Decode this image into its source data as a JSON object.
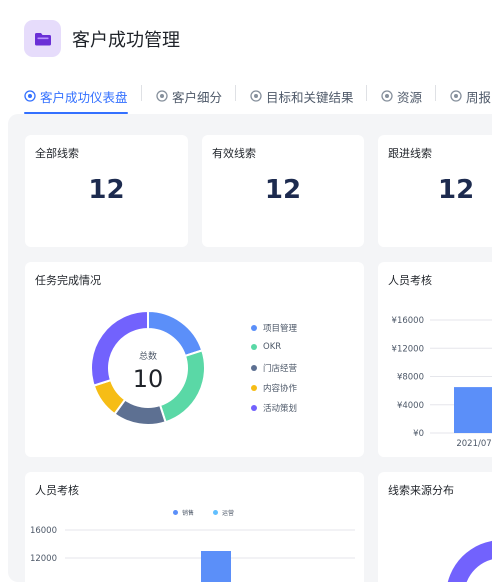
{
  "app": {
    "title": "客户成功管理",
    "icon": "folder-icon",
    "icon_bg": "#e6dcfb",
    "icon_color": "#6a2fd6"
  },
  "tabs": [
    {
      "label": "客户成功仪表盘",
      "active": true
    },
    {
      "label": "客户细分",
      "active": false
    },
    {
      "label": "目标和关键结果",
      "active": false
    },
    {
      "label": "资源",
      "active": false
    },
    {
      "label": "周报",
      "active": false
    }
  ],
  "stats": [
    {
      "title": "全部线索",
      "value": "12"
    },
    {
      "title": "有效线索",
      "value": "12"
    },
    {
      "title": "跟进线索",
      "value": "12"
    }
  ],
  "task_card": {
    "title": "任务完成情况",
    "center_label": "总数",
    "center_value": "10"
  },
  "people_card_top": {
    "title": "人员考核"
  },
  "people_card_bottom": {
    "title": "人员考核"
  },
  "source_card": {
    "title": "线索来源分布"
  },
  "colors": {
    "accent": "#3370ff",
    "project": "#5b8ff9",
    "okr": "#5ad8a6",
    "store": "#5d7092",
    "content": "#f6bd16",
    "activity": "#7262fd",
    "sales": "#5b8ff9",
    "ops": "#61bfff"
  },
  "chart_data": [
    {
      "type": "pie",
      "title": "任务完成情况",
      "categories": [
        "项目管理",
        "OKR",
        "门店经营",
        "内容协作",
        "活动策划"
      ],
      "values": [
        2,
        2.5,
        1.5,
        1,
        3
      ]
    },
    {
      "type": "bar",
      "title": "人员考核",
      "categories": [
        "2021/07"
      ],
      "series": [
        {
          "values": [
            6500
          ]
        }
      ],
      "yticks": [
        "¥16000",
        "¥12000",
        "¥8000",
        "¥4000",
        "¥0"
      ],
      "ylim": [
        0,
        16000
      ]
    },
    {
      "type": "bar",
      "title": "人员考核",
      "series": [
        {
          "name": "销售",
          "values": [
            13000
          ]
        },
        {
          "name": "运营",
          "values": []
        }
      ],
      "yticks": [
        "16000",
        "12000"
      ],
      "ylim": [
        0,
        16000
      ]
    },
    {
      "type": "pie",
      "title": "线索来源分布",
      "values": []
    }
  ]
}
